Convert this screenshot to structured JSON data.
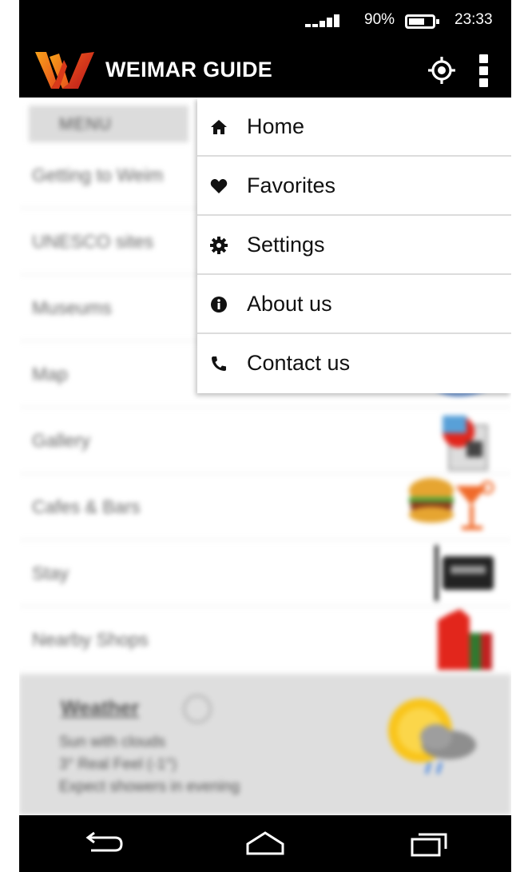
{
  "status_bar": {
    "battery_percent": "90%",
    "time": "23:33",
    "icons": [
      "signal-icon",
      "battery-icon"
    ]
  },
  "header": {
    "title": "WEIMAR GUIDE",
    "icons": [
      "weimar-logo",
      "locate-icon",
      "overflow-menu-icon"
    ]
  },
  "background_menu": {
    "header": "MENU",
    "items": [
      {
        "label": "Getting to Weim"
      },
      {
        "label": "UNESCO sites"
      },
      {
        "label": "Museums"
      },
      {
        "label": "Map"
      },
      {
        "label": "Gallery"
      },
      {
        "label": "Cafes & Bars"
      },
      {
        "label": "Stay"
      },
      {
        "label": "Nearby Shops"
      }
    ]
  },
  "weather": {
    "title": "Weather",
    "line1": "Sun with clouds",
    "line2": "3° Real Feel (-1°)",
    "line3": "Expect showers in evening",
    "icon": "sun-cloud-rain-icon"
  },
  "dropdown_menu": {
    "items": [
      {
        "label": "Home",
        "icon": "home-icon"
      },
      {
        "label": "Favorites",
        "icon": "heart-icon"
      },
      {
        "label": "Settings",
        "icon": "gear-icon"
      },
      {
        "label": "About us",
        "icon": "info-icon"
      },
      {
        "label": "Contact us",
        "icon": "phone-icon"
      }
    ]
  },
  "nav_bar": {
    "icons": [
      "back-icon",
      "home-nav-icon",
      "recents-icon"
    ]
  },
  "colors": {
    "bar_background": "#000000",
    "logo_orange": "#f28c1c",
    "logo_red": "#e2261c"
  }
}
